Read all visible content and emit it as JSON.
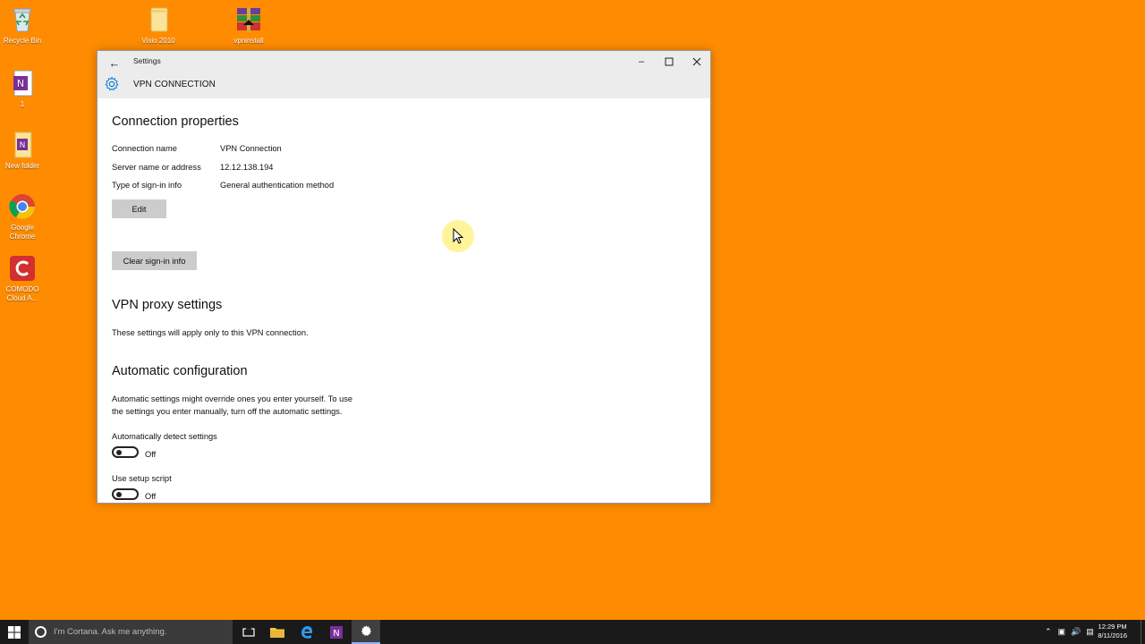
{
  "desktop": {
    "icons": [
      {
        "label": "Recycle Bin"
      },
      {
        "label": "Visio 2010"
      },
      {
        "label": "vpninstall"
      },
      {
        "label": "1"
      },
      {
        "label": "New folder"
      },
      {
        "label": "Google Chrome"
      },
      {
        "label": "COMODO Cloud A..."
      }
    ]
  },
  "window": {
    "title": "Settings",
    "page_title": "VPN CONNECTION"
  },
  "connection_properties": {
    "heading": "Connection properties",
    "rows": [
      {
        "label": "Connection name",
        "value": "VPN Connection"
      },
      {
        "label": "Server name or address",
        "value": "12.12.138.194"
      },
      {
        "label": "Type of sign-in info",
        "value": "General authentication method"
      }
    ],
    "edit_label": "Edit",
    "clear_label": "Clear sign-in info"
  },
  "proxy": {
    "heading": "VPN proxy settings",
    "description": "These settings will apply only to this VPN connection."
  },
  "auto_config": {
    "heading": "Automatic configuration",
    "description_line1": "Automatic settings might override ones you enter yourself. To use",
    "description_line2": "the settings you enter manually, turn off the automatic settings.",
    "detect_label": "Automatically detect settings",
    "detect_state": "Off",
    "script_label": "Use setup script",
    "script_state": "Off"
  },
  "taskbar": {
    "search_placeholder": "I'm Cortana. Ask me anything.",
    "time": "12:29 PM",
    "date": "8/11/2016"
  },
  "colors": {
    "desktop_bg": "#ff8c00",
    "accent": "#0078d7"
  }
}
